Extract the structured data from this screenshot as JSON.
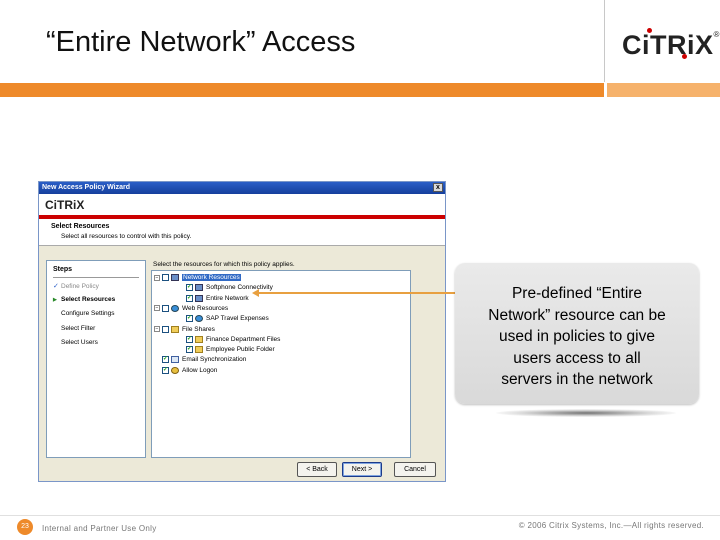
{
  "slide": {
    "title": "“Entire Network” Access",
    "logo_text": "CiTRiX",
    "logo_reg": "®",
    "page_number": "23",
    "footer_left": "Internal and Partner Use Only",
    "footer_right": "© 2006 Citrix Systems, Inc.—All rights reserved."
  },
  "colors": {
    "accent_orange": "#ee8a2a",
    "citrix_red": "#cc0000",
    "titlebar_blue": "#2a5ec7"
  },
  "wizard": {
    "window_title": "New Access Policy Wizard",
    "close_label": "x",
    "logo_text": "CiTRiX",
    "section_title": "Select Resources",
    "section_subtitle": "Select all resources to control with this policy.",
    "steps_title": "Steps",
    "steps": [
      {
        "label": "Define Policy",
        "state": "done",
        "mark": "✓"
      },
      {
        "label": "Select Resources",
        "state": "current",
        "mark": "▶"
      },
      {
        "label": "Configure Settings",
        "state": "pending",
        "mark": ""
      },
      {
        "label": "Select Filter",
        "state": "pending",
        "mark": ""
      },
      {
        "label": "Select Users",
        "state": "pending",
        "mark": ""
      }
    ],
    "tree_label": "Select the resources for which this policy applies.",
    "tree": [
      {
        "label": "Network Resources",
        "expander": "−",
        "checked": false,
        "icon": "network-icon",
        "selected": true
      },
      {
        "label": "Softphone Connectivity",
        "expander": "",
        "checked": true,
        "icon": "network-icon",
        "selected": false
      },
      {
        "label": "Entire Network",
        "expander": "",
        "checked": true,
        "icon": "network-icon",
        "selected": false
      },
      {
        "label": "Web Resources",
        "expander": "−",
        "checked": false,
        "icon": "web-icon",
        "selected": false
      },
      {
        "label": "SAP Travel Expenses",
        "expander": "",
        "checked": true,
        "icon": "web-icon",
        "selected": false
      },
      {
        "label": "File Shares",
        "expander": "−",
        "checked": false,
        "icon": "folder-icon",
        "selected": false
      },
      {
        "label": "Finance Department Files",
        "expander": "",
        "checked": true,
        "icon": "folder-icon",
        "selected": false
      },
      {
        "label": "Employee Public Folder",
        "expander": "",
        "checked": true,
        "icon": "folder-icon",
        "selected": false
      },
      {
        "label": "Email Synchronization",
        "expander": "",
        "checked": true,
        "icon": "mail-icon",
        "selected": false
      },
      {
        "label": "Allow Logon",
        "expander": "",
        "checked": true,
        "icon": "key-icon",
        "selected": false
      }
    ],
    "check_glyph": "✓",
    "buttons": {
      "back": "< Back",
      "next": "Next >",
      "cancel": "Cancel"
    }
  },
  "callout": {
    "lines": [
      "Pre-defined “Entire",
      "Network” resource can be",
      "used in policies to give",
      "users access to all",
      "servers in the network"
    ]
  }
}
